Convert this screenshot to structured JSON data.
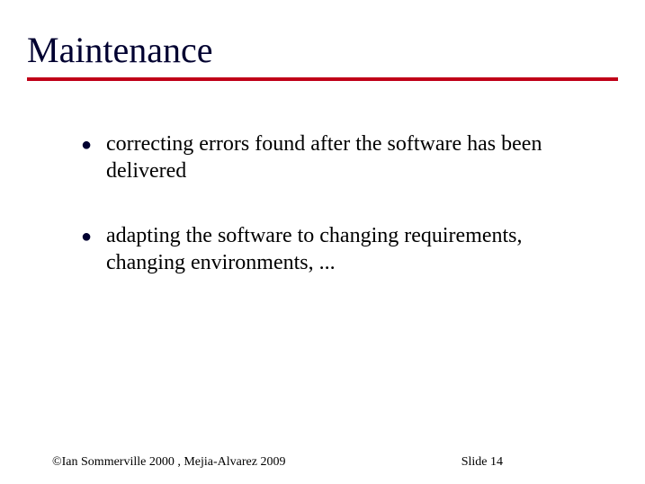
{
  "title": "Maintenance",
  "bullets": [
    "correcting errors found after the software has been delivered",
    "adapting the software to changing requirements, changing environments, ..."
  ],
  "footer": {
    "copyright": "©Ian Sommerville 2000 , Mejia-Alvarez 2009",
    "slide_label": "Slide  14"
  },
  "glyphs": {
    "bullet": "●"
  }
}
